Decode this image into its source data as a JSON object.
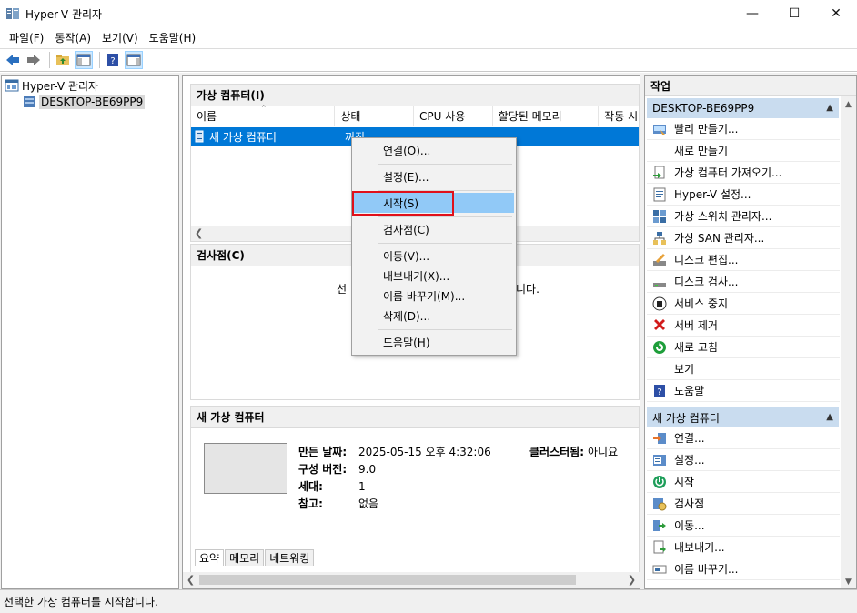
{
  "window": {
    "title": "Hyper-V 관리자"
  },
  "menu": [
    "파일(F)",
    "동작(A)",
    "보기(V)",
    "도움말(H)"
  ],
  "tree": {
    "root": "Hyper-V 관리자",
    "child": "DESKTOP-BE69PP9"
  },
  "vm_list": {
    "header": "가상 컴퓨터(I)",
    "columns": [
      "이름",
      "상태",
      "CPU 사용",
      "할당된 메모리",
      "작동 시"
    ],
    "row": {
      "name": "새 가상 컴퓨터",
      "state": "꺼짐"
    }
  },
  "checkpoints": {
    "header": "검사점(C)",
    "message_left": "선",
    "message_right": "니다."
  },
  "details": {
    "header": "새 가상 컴퓨터",
    "created_label": "만든 날짜:",
    "created_value": "2025-05-15 오후 4:32:06",
    "config_label": "구성 버전:",
    "config_value": "9.0",
    "gen_label": "세대:",
    "gen_value": "1",
    "notes_label": "참고:",
    "notes_value": "없음",
    "cluster_label": "클러스터됨:",
    "cluster_value": "아니요",
    "tabs": [
      "요약",
      "메모리",
      "네트워킹"
    ]
  },
  "actions": {
    "title": "작업",
    "group1": {
      "label": "DESKTOP-BE69PP9",
      "items": [
        {
          "label": "빨리 만들기...",
          "icon": "quick-create-icon"
        },
        {
          "label": "새로 만들기",
          "icon": "none",
          "submenu": true
        },
        {
          "label": "가상 컴퓨터 가져오기...",
          "icon": "import-vm-icon"
        },
        {
          "label": "Hyper-V 설정...",
          "icon": "settings-icon"
        },
        {
          "label": "가상 스위치 관리자...",
          "icon": "switch-manager-icon"
        },
        {
          "label": "가상 SAN 관리자...",
          "icon": "san-manager-icon"
        },
        {
          "label": "디스크 편집...",
          "icon": "edit-disk-icon"
        },
        {
          "label": "디스크 검사...",
          "icon": "inspect-disk-icon"
        },
        {
          "label": "서비스 중지",
          "icon": "stop-service-icon"
        },
        {
          "label": "서버 제거",
          "icon": "remove-server-icon"
        },
        {
          "label": "새로 고침",
          "icon": "refresh-icon"
        },
        {
          "label": "보기",
          "icon": "none",
          "submenu": true
        },
        {
          "label": "도움말",
          "icon": "help-icon"
        }
      ]
    },
    "group2": {
      "label": "새 가상 컴퓨터",
      "items": [
        {
          "label": "연결...",
          "icon": "connect-icon"
        },
        {
          "label": "설정...",
          "icon": "vm-settings-icon"
        },
        {
          "label": "시작",
          "icon": "start-icon"
        },
        {
          "label": "검사점",
          "icon": "checkpoint-icon"
        },
        {
          "label": "이동...",
          "icon": "move-icon"
        },
        {
          "label": "내보내기...",
          "icon": "export-icon"
        },
        {
          "label": "이름 바꾸기...",
          "icon": "rename-icon"
        }
      ]
    }
  },
  "context_menu": {
    "items": [
      "연결(O)...",
      "설정(E)...",
      "시작(S)",
      "검사점(C)",
      "이동(V)...",
      "내보내기(X)...",
      "이름 바꾸기(M)...",
      "삭제(D)...",
      "도움말(H)"
    ],
    "highlighted": "시작(S)"
  },
  "status": "선택한 가상 컴퓨터를 시작합니다.",
  "colors": {
    "selection": "#0078d7",
    "menu_highlight": "#91c9f7",
    "group_header": "#c9dcef",
    "annotation_box": "#e0101a"
  }
}
